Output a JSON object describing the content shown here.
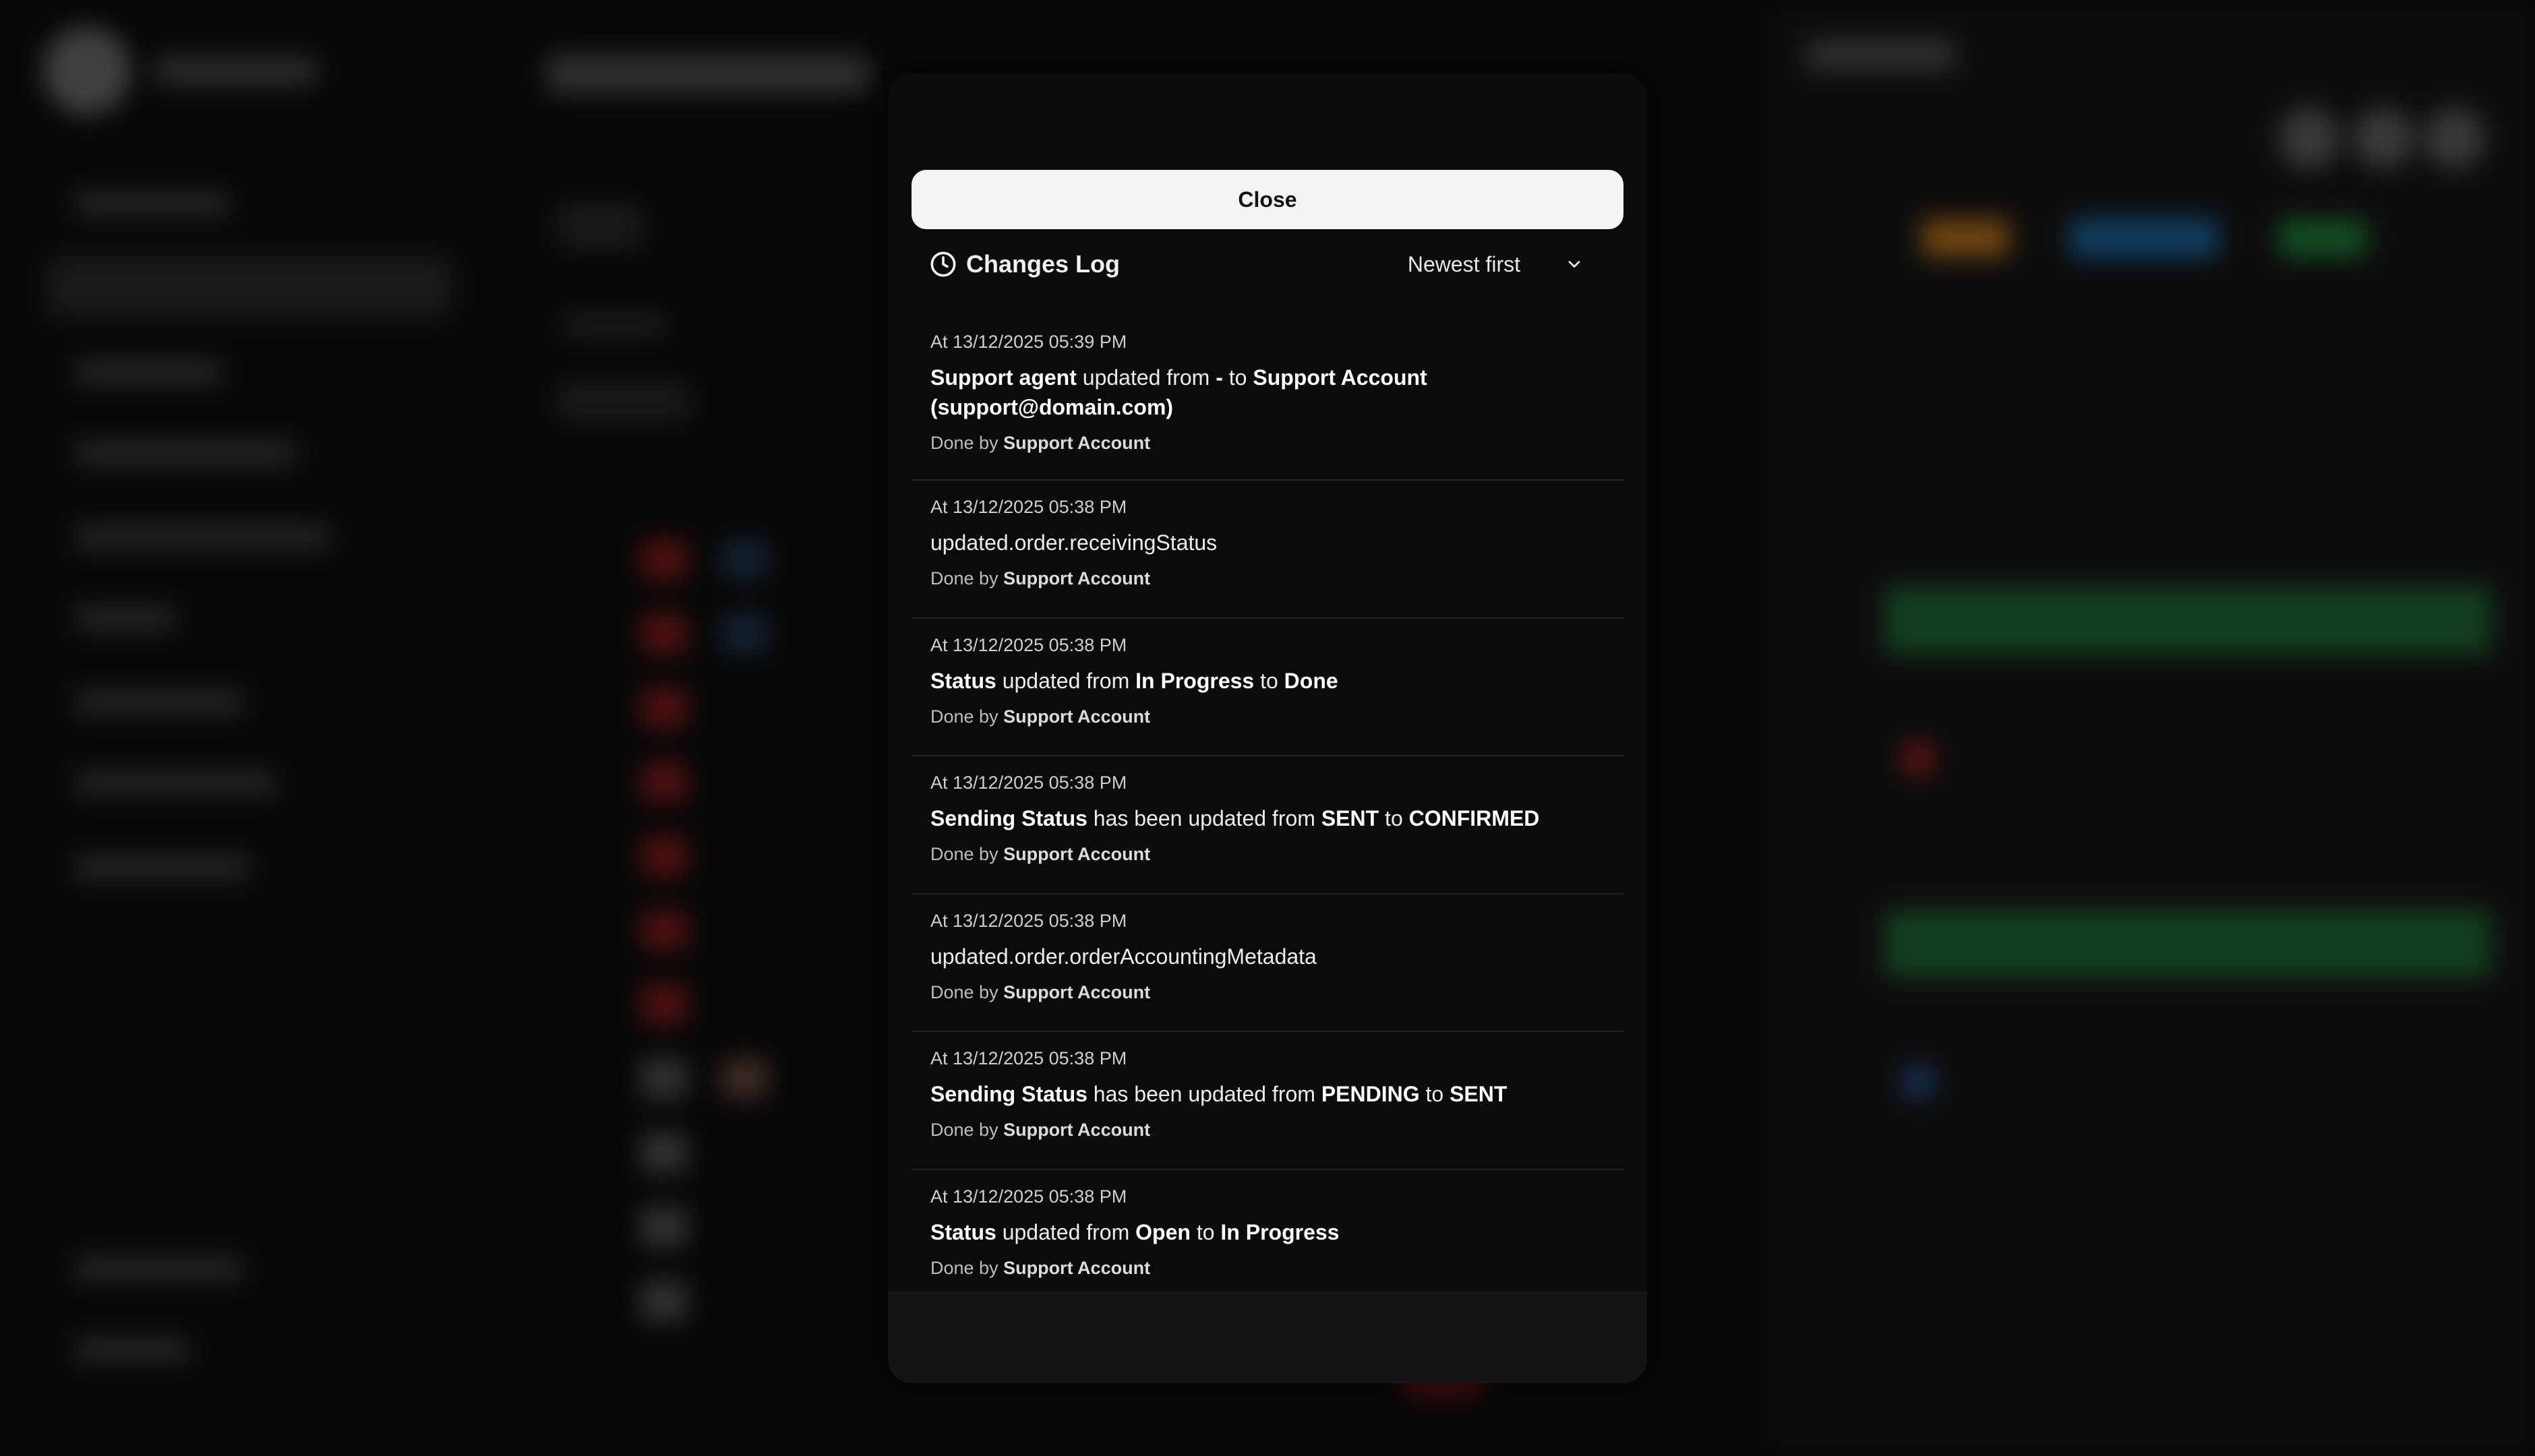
{
  "modal": {
    "title": "Changes Log",
    "title_icon": "clock-icon",
    "sort": {
      "selected": "Newest first",
      "icon": "chevron-down-icon"
    },
    "entries": [
      {
        "time": "At 13/12/2025 05:39 PM",
        "parts": [
          {
            "bold": true,
            "text": "Support agent"
          },
          {
            "bold": false,
            "text": " updated from "
          },
          {
            "bold": true,
            "text": "-"
          },
          {
            "bold": false,
            "text": " to "
          },
          {
            "bold": true,
            "text": "Support Account (support@domain.com)"
          }
        ],
        "done_prefix": "Done by ",
        "done_by": "Support Account"
      },
      {
        "time": "At 13/12/2025 05:38 PM",
        "parts": [
          {
            "bold": false,
            "text": "updated.order.receivingStatus"
          }
        ],
        "done_prefix": "Done by ",
        "done_by": "Support Account"
      },
      {
        "time": "At 13/12/2025 05:38 PM",
        "parts": [
          {
            "bold": true,
            "text": "Status"
          },
          {
            "bold": false,
            "text": " updated from "
          },
          {
            "bold": true,
            "text": "In Progress"
          },
          {
            "bold": false,
            "text": " to "
          },
          {
            "bold": true,
            "text": "Done"
          }
        ],
        "done_prefix": "Done by ",
        "done_by": "Support Account"
      },
      {
        "time": "At 13/12/2025 05:38 PM",
        "parts": [
          {
            "bold": true,
            "text": "Sending Status"
          },
          {
            "bold": false,
            "text": " has been updated from "
          },
          {
            "bold": true,
            "text": "SENT"
          },
          {
            "bold": false,
            "text": " to "
          },
          {
            "bold": true,
            "text": "CONFIRMED"
          }
        ],
        "done_prefix": "Done by ",
        "done_by": "Support Account"
      },
      {
        "time": "At 13/12/2025 05:38 PM",
        "parts": [
          {
            "bold": false,
            "text": "updated.order.orderAccountingMetadata"
          }
        ],
        "done_prefix": "Done by ",
        "done_by": "Support Account"
      },
      {
        "time": "At 13/12/2025 05:38 PM",
        "parts": [
          {
            "bold": true,
            "text": "Sending Status"
          },
          {
            "bold": false,
            "text": " has been updated from "
          },
          {
            "bold": true,
            "text": "PENDING"
          },
          {
            "bold": false,
            "text": " to "
          },
          {
            "bold": true,
            "text": "SENT"
          }
        ],
        "done_prefix": "Done by ",
        "done_by": "Support Account"
      },
      {
        "time": "At 13/12/2025 05:38 PM",
        "parts": [
          {
            "bold": true,
            "text": "Status"
          },
          {
            "bold": false,
            "text": " updated from "
          },
          {
            "bold": true,
            "text": "Open"
          },
          {
            "bold": false,
            "text": " to "
          },
          {
            "bold": true,
            "text": "In Progress"
          }
        ],
        "done_prefix": "Done by ",
        "done_by": "Support Account"
      }
    ],
    "close_label": "Close"
  },
  "colors": {
    "modal_bg": "#0b0b0b",
    "footer_bg": "#141414",
    "close_bg": "#f5f5f5",
    "divider": "#242424"
  }
}
